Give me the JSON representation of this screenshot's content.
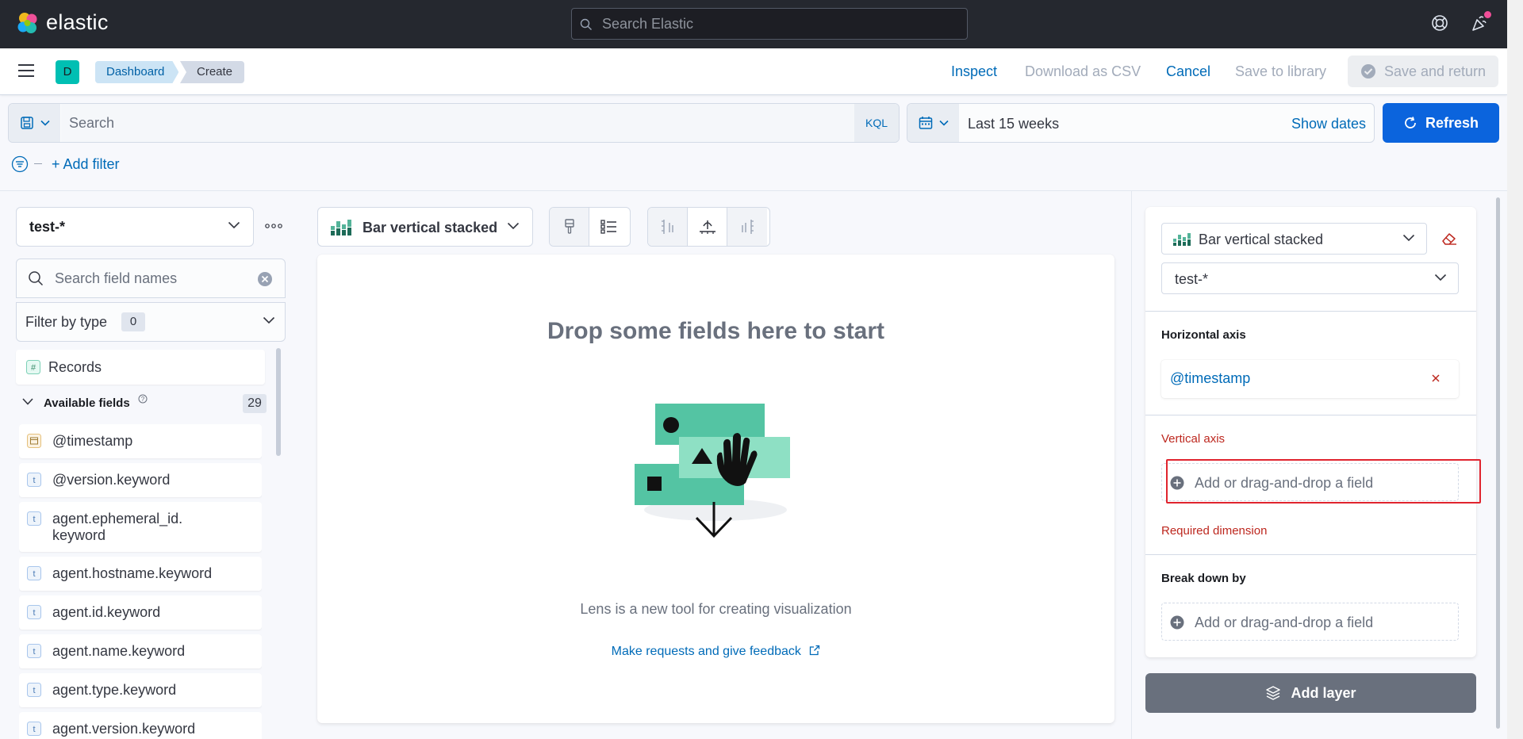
{
  "app": {
    "brand": "elastic"
  },
  "header": {
    "search_placeholder": "Search Elastic",
    "news_indicator_color": "#f04e98"
  },
  "subheader": {
    "space_initial": "D",
    "breadcrumbs": [
      "Dashboard",
      "Create"
    ],
    "actions": {
      "inspect": "Inspect",
      "download_csv": "Download as CSV",
      "cancel": "Cancel",
      "save_to_library": "Save to library",
      "save_and_return": "Save and return"
    }
  },
  "query_bar": {
    "search_placeholder": "Search",
    "language": "KQL",
    "date_range": "Last 15 weeks",
    "show_dates": "Show dates",
    "refresh": "Refresh",
    "add_filter": "+ Add filter"
  },
  "sidebar": {
    "index_pattern": "test-*",
    "field_search_placeholder": "Search field names",
    "filter_by_type": "Filter by type",
    "filter_count": "0",
    "records": "Records",
    "available_fields_label": "Available fields",
    "available_fields_count": "29",
    "fields": [
      {
        "name": "@timestamp",
        "type": "date"
      },
      {
        "name": "@version.keyword",
        "type": "t"
      },
      {
        "name": "agent.ephemeral_id.\nkeyword",
        "type": "t"
      },
      {
        "name": "agent.hostname.keyword",
        "type": "t"
      },
      {
        "name": "agent.id.keyword",
        "type": "t"
      },
      {
        "name": "agent.name.keyword",
        "type": "t"
      },
      {
        "name": "agent.type.keyword",
        "type": "t"
      },
      {
        "name": "agent.version.keyword",
        "type": "t"
      }
    ]
  },
  "workspace": {
    "chart_type": "Bar vertical stacked",
    "empty_title": "Drop some fields here to start",
    "description": "Lens is a new tool for creating visualization",
    "feedback_link": "Make requests and give feedback"
  },
  "config": {
    "layer_chart_type": "Bar vertical stacked",
    "layer_index": "test-*",
    "horizontal_axis": {
      "title": "Horizontal axis",
      "field": "@timestamp"
    },
    "vertical_axis": {
      "title": "Vertical axis",
      "placeholder": "Add or drag-and-drop a field",
      "error": "Required dimension"
    },
    "break_down": {
      "title": "Break down by",
      "placeholder": "Add or drag-and-drop a field"
    },
    "add_layer": "Add layer"
  },
  "colors": {
    "header_bg": "#25282f",
    "link": "#006bb8",
    "primary": "#0b64dd",
    "danger": "#bd271e",
    "illustration_green": "#54c4a3"
  }
}
